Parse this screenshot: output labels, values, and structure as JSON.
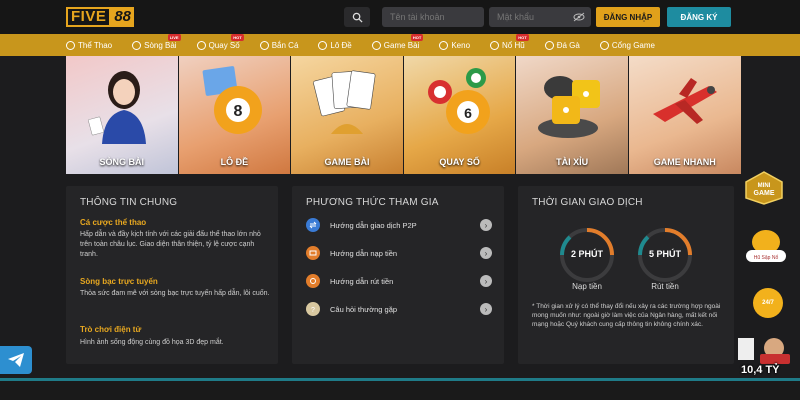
{
  "header": {
    "logo_text": "FIVE",
    "logo_num": "88",
    "username_placeholder": "Tên tài khoản",
    "password_placeholder": "Mật khẩu",
    "login_label": "ĐĂNG NHẬP",
    "register_label": "ĐĂNG KÝ"
  },
  "nav": {
    "items": [
      {
        "label": "Thể Thao",
        "badge": ""
      },
      {
        "label": "Sòng Bài",
        "badge": "LIVE"
      },
      {
        "label": "Quay Số",
        "badge": "HOT"
      },
      {
        "label": "Bắn Cá",
        "badge": ""
      },
      {
        "label": "Lô Đề",
        "badge": ""
      },
      {
        "label": "Game Bài",
        "badge": "HOT"
      },
      {
        "label": "Keno",
        "badge": ""
      },
      {
        "label": "Nổ Hũ",
        "badge": "HOT"
      },
      {
        "label": "Đá Gà",
        "badge": ""
      },
      {
        "label": "Cổng Game",
        "badge": ""
      }
    ]
  },
  "games": [
    {
      "label": "SÒNG BÀI"
    },
    {
      "label": "LÔ ĐỀ"
    },
    {
      "label": "GAME BÀI"
    },
    {
      "label": "QUAY SỐ"
    },
    {
      "label": "TÀI XỈU"
    },
    {
      "label": "GAME NHANH"
    }
  ],
  "info": {
    "title": "THÔNG TIN CHUNG",
    "sections": [
      {
        "heading": "Cá cược thể thao",
        "text": "Hấp dẫn và đầy kịch tính với các giải đấu thể thao lớn nhỏ trên toàn châu lục. Giao diện thân thiện, tỷ lệ cược cạnh tranh."
      },
      {
        "heading": "Sòng bạc trực tuyến",
        "text": "Thỏa sức đam mê với sòng bạc trực tuyến hấp dẫn, lôi cuốn."
      },
      {
        "heading": "Trò chơi điện tử",
        "text": "Hình ảnh sống động cùng đồ họa 3D đẹp mắt."
      }
    ]
  },
  "methods": {
    "title": "PHƯƠNG THỨC THAM GIA",
    "items": [
      {
        "label": "Hướng dẫn giao dịch P2P",
        "color": "#3a7bd5"
      },
      {
        "label": "Hướng dẫn nạp tiền",
        "color": "#e27d2b"
      },
      {
        "label": "Hướng dẫn rút tiền",
        "color": "#e27d2b"
      },
      {
        "label": "Câu hỏi thường gặp",
        "color": "#d8c8a0"
      }
    ]
  },
  "timing": {
    "title": "THỜI GIAN GIAO DỊCH",
    "deposit_value": "2 PHÚT",
    "deposit_label": "Nạp tiền",
    "withdraw_value": "5 PHÚT",
    "withdraw_label": "Rút tiền",
    "note": "* Thời gian xử lý có thể thay đổi nếu xảy ra các trường hợp ngoài mong muốn như: ngoài giờ làm việc của Ngân hàng, mất kết nối mạng hoặc Quý khách cung cấp thông tin không chính xác."
  },
  "floating": {
    "mini_game": "MINI GAME",
    "no_hu": "Hũ Sập Nổ",
    "support": "24/7",
    "jackpot": "10,4 TỶ"
  },
  "colors": {
    "accent": "#e0a11b",
    "nav_bg": "#c8961c",
    "register_bg": "#1e8ca0"
  }
}
